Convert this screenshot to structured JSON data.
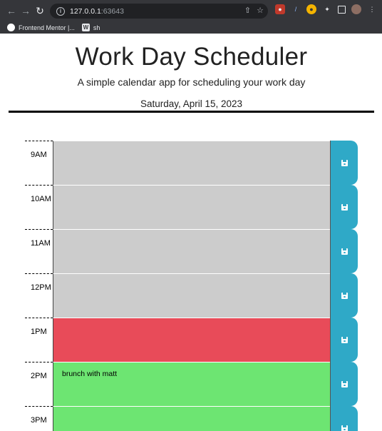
{
  "browser": {
    "url_host": "127.0.0.1",
    "url_port": ":63643",
    "bookmarks": [
      {
        "label": "Frontend Mentor |..."
      },
      {
        "label": "sh",
        "icon_letter": "W"
      }
    ]
  },
  "header": {
    "title": "Work Day Scheduler",
    "lead": "A simple calendar app for scheduling your work day",
    "current_date": "Saturday, April 15, 2023"
  },
  "colors": {
    "past": "#cccccc",
    "present": "#e84b59",
    "future": "#6de572",
    "save_button": "#2fa9c7"
  },
  "time_blocks": [
    {
      "hour": "9AM",
      "text": "",
      "status": "past"
    },
    {
      "hour": "10AM",
      "text": "",
      "status": "past"
    },
    {
      "hour": "11AM",
      "text": "",
      "status": "past"
    },
    {
      "hour": "12PM",
      "text": "",
      "status": "past"
    },
    {
      "hour": "1PM",
      "text": "",
      "status": "present"
    },
    {
      "hour": "2PM",
      "text": "brunch with matt",
      "status": "future"
    },
    {
      "hour": "3PM",
      "text": "",
      "status": "future"
    }
  ],
  "icons": {
    "save": "floppy-disk-icon"
  }
}
